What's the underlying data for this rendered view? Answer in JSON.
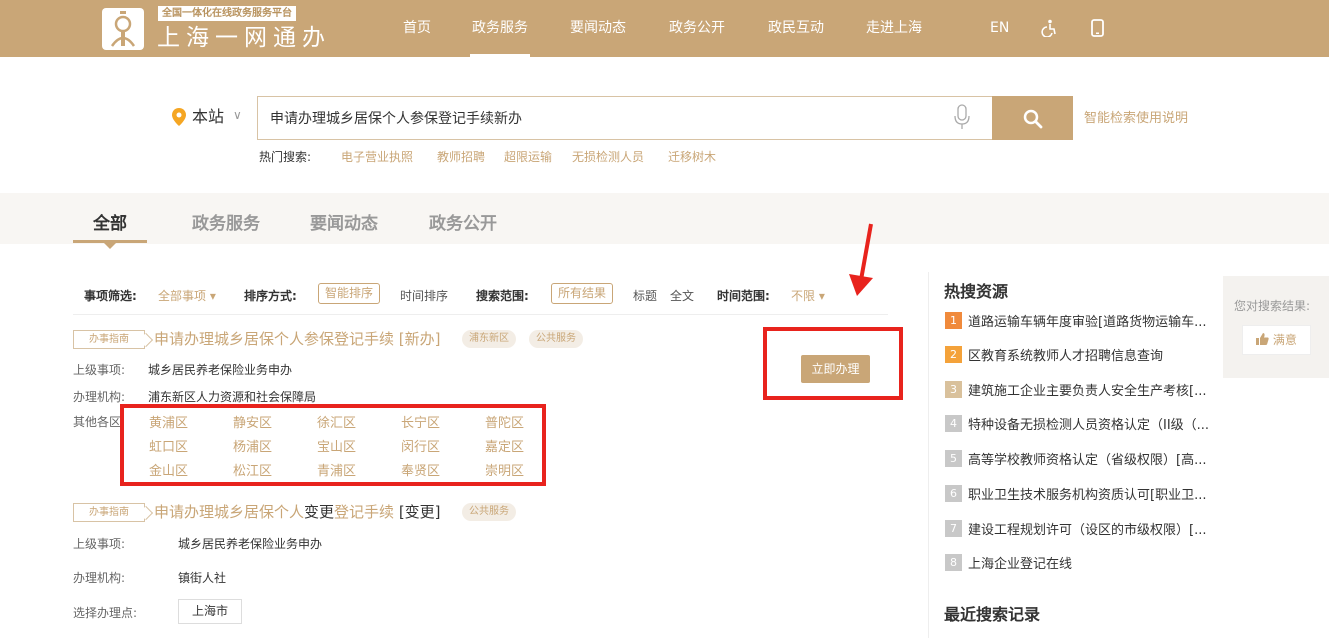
{
  "header": {
    "logo_small": "全国一体化在线政务服务平台",
    "logo_big": "上海一网通办",
    "nav": [
      "首页",
      "政务服务",
      "要闻动态",
      "政务公开",
      "政民互动",
      "走进上海"
    ],
    "active_nav": "政务服务",
    "lang": "EN"
  },
  "search": {
    "location": "本站",
    "query": "申请办理城乡居保个人参保登记手续新办",
    "help": "智能检索使用说明",
    "hot_label": "热门搜索:",
    "hot": [
      "电子营业执照",
      "教师招聘",
      "超限运输",
      "无损检测人员",
      "迁移树木"
    ]
  },
  "tabs": [
    "全部",
    "政务服务",
    "要闻动态",
    "政务公开"
  ],
  "filters": {
    "item_label": "事项筛选:",
    "item_value": "全部事项",
    "sort_label": "排序方式:",
    "sort_active": "智能排序",
    "sort_other": "时间排序",
    "scope_label": "搜索范围:",
    "scope_active": "所有结果",
    "scope_title": "标题",
    "scope_full": "全文",
    "time_label": "时间范围:",
    "time_value": "不限"
  },
  "results": [
    {
      "tag": "办事指南",
      "title_a": "申请办理城乡居保个人参保登记手续",
      "title_b": "[新办]",
      "pills": [
        "浦东新区",
        "公共服务"
      ],
      "parent_label": "上级事项:",
      "parent": "城乡居民养老保险业务申办",
      "org_label": "办理机构:",
      "org": "浦东新区人力资源和社会保障局",
      "districts_label": "其他各区:",
      "districts": [
        "黄浦区",
        "静安区",
        "徐汇区",
        "长宁区",
        "普陀区",
        "虹口区",
        "杨浦区",
        "宝山区",
        "闵行区",
        "嘉定区",
        "金山区",
        "松江区",
        "青浦区",
        "奉贤区",
        "崇明区"
      ],
      "apply": "立即办理"
    },
    {
      "tag": "办事指南",
      "title_a": "申请办理城乡居保个人",
      "title_dark": "变更",
      "title_c": "登记手续",
      "title_b": "[变更]",
      "pills": [
        "公共服务"
      ],
      "parent_label": "上级事项:",
      "parent": "城乡居民养老保险业务申办",
      "org_label": "办理机构:",
      "org": "镇街人社",
      "point_label": "选择办理点:",
      "point": "上海市"
    }
  ],
  "sidebar": {
    "hot_title": "热搜资源",
    "hot": [
      "道路运输车辆年度审验[道路货物运输车...",
      "区教育系统教师人才招聘信息查询",
      "建筑施工企业主要负责人安全生产考核[...",
      "特种设备无损检测人员资格认定（II级（...",
      "高等学校教师资格认定（省级权限）[高...",
      "职业卫生技术服务机构资质认可[职业卫...",
      "建设工程规划许可（设区的市级权限）[...",
      "上海企业登记在线"
    ],
    "rank_colors": [
      "#f08a3c",
      "#f4a23a",
      "#d9c19c",
      "#c8c8c8",
      "#c8c8c8",
      "#c8c8c8",
      "#c8c8c8",
      "#c8c8c8"
    ],
    "recent_title": "最近搜索记录"
  },
  "feedback": {
    "label": "您对搜索结果:",
    "satisfied": "满意"
  }
}
